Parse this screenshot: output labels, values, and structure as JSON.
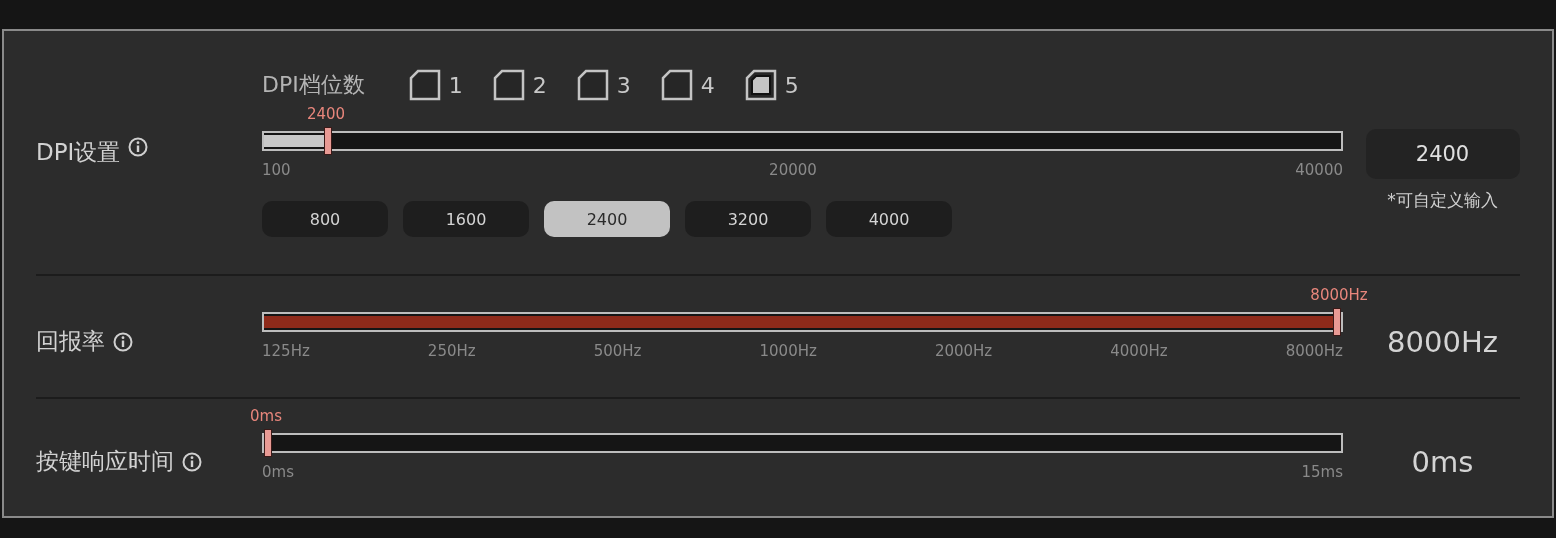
{
  "settings": [
    {
      "kind": "dpi",
      "label": "DPI设置",
      "stages": {
        "label": "DPI档位数",
        "items": [
          {
            "label": "1",
            "selected": false
          },
          {
            "label": "2",
            "selected": false
          },
          {
            "label": "3",
            "selected": false
          },
          {
            "label": "4",
            "selected": false
          },
          {
            "label": "5",
            "selected": true
          }
        ]
      },
      "slider": {
        "level": 0.056,
        "reading": "2400",
        "ticks": [
          "100",
          "20000",
          "40000"
        ]
      },
      "presets": [
        {
          "label": "800",
          "selected": false
        },
        {
          "label": "1600",
          "selected": false
        },
        {
          "label": "2400",
          "selected": true
        },
        {
          "label": "3200",
          "selected": false
        },
        {
          "label": "4000",
          "selected": false
        }
      ],
      "input": {
        "value": "2400",
        "hint": "*可自定义输入"
      }
    },
    {
      "kind": "rate",
      "label": "回报率",
      "slider": {
        "level": 1,
        "reading": "8000Hz",
        "ticks": [
          "125Hz",
          "250Hz",
          "500Hz",
          "1000Hz",
          "2000Hz",
          "4000Hz",
          "8000Hz"
        ]
      },
      "value": "8000Hz"
    },
    {
      "kind": "response",
      "label": "按键响应时间",
      "slider": {
        "level": 0,
        "reading": "0ms",
        "ticks": [
          "0ms",
          "15ms"
        ]
      },
      "value": "0ms"
    }
  ]
}
